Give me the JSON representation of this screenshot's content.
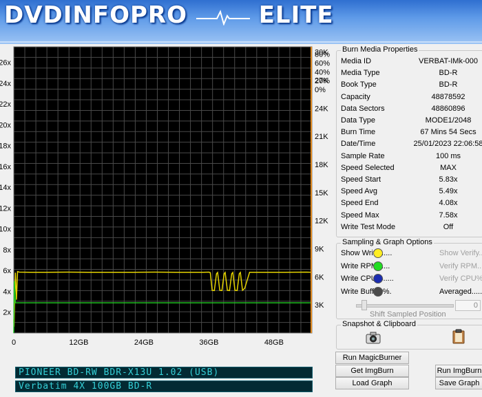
{
  "banner": {
    "left_text": "DVDINFOPRO",
    "right_text": "ELITE"
  },
  "chart_data": {
    "type": "line",
    "xlabel": "",
    "ylabel": "",
    "x_ticks": [
      "0",
      "12GB",
      "24GB",
      "36GB",
      "48GB"
    ],
    "x_range": [
      0,
      55
    ],
    "y_left_ticks": [
      "2x",
      "4x",
      "6x",
      "8x",
      "10x",
      "12x",
      "14x",
      "16x",
      "18x",
      "20x",
      "22x",
      "24x",
      "26x"
    ],
    "y_left_range": [
      0,
      27.5
    ],
    "y_right_ticks_rpm": [
      "3K",
      "6K",
      "9K",
      "12K",
      "15K",
      "18K",
      "21K",
      "24K",
      "27K",
      "30K"
    ],
    "y_right_ticks_percent": [
      "0%",
      "20%",
      "40%",
      "60%",
      "80%"
    ],
    "grid": true,
    "series": [
      {
        "color": "#e6d400",
        "x": [
          0,
          0.05,
          0.15,
          0.3,
          0.5,
          0.7,
          1,
          3,
          6,
          10,
          14,
          18,
          22,
          26,
          30,
          33,
          35,
          36,
          36.25,
          36.6,
          37,
          37.4,
          37.6,
          38,
          38.4,
          38.8,
          39,
          39.4,
          39.8,
          40.2,
          40.4,
          40.8,
          41.2,
          41.6,
          41.8,
          42.2,
          42.6,
          43.5,
          46,
          50,
          54,
          55
        ],
        "y": [
          1.3,
          0.6,
          3,
          5.8,
          3.2,
          5.9,
          5.85,
          5.83,
          5.83,
          5.85,
          5.83,
          5.84,
          5.83,
          5.85,
          5.83,
          5.84,
          5.83,
          5.85,
          5.8,
          4.1,
          4.08,
          5.7,
          5.82,
          4.1,
          4.08,
          5.7,
          5.82,
          4.1,
          4.08,
          5.7,
          5.82,
          4.1,
          4.08,
          5.7,
          5.82,
          4.1,
          4.3,
          5.83,
          5.84,
          5.83,
          5.85,
          5.83
        ]
      },
      {
        "color": "#1fc01f",
        "x": [
          0,
          0.1,
          0.3,
          55
        ],
        "y": [
          0,
          5,
          2.9,
          2.9
        ]
      }
    ]
  },
  "props": {
    "title": "Burn Media Properties",
    "rows": [
      {
        "label": "Media ID",
        "value": "VERBAT-IMk-000"
      },
      {
        "label": "Media Type",
        "value": "BD-R"
      },
      {
        "label": "Book Type",
        "value": "BD-R"
      },
      {
        "label": "Capacity",
        "value": "48878592"
      },
      {
        "label": "Data Sectors",
        "value": "48860896"
      },
      {
        "label": "Data Type",
        "value": "MODE1/2048"
      },
      {
        "label": "Burn Time",
        "value": "67 Mins 54 Secs"
      },
      {
        "label": "Date/Time",
        "value": "25/01/2023 22:06:58"
      },
      {
        "label": "Sample Rate",
        "value": "100 ms"
      },
      {
        "label": "Speed Selected",
        "value": "MAX"
      },
      {
        "label": "Speed Start",
        "value": "5.83x"
      },
      {
        "label": "Speed Avg",
        "value": "5.49x"
      },
      {
        "label": "Speed End",
        "value": "4.08x"
      },
      {
        "label": "Speed Max",
        "value": "7.58x"
      },
      {
        "label": "Write Test Mode",
        "value": "Off"
      }
    ]
  },
  "sampling": {
    "title": "Sampling & Graph Options",
    "options": [
      {
        "label": "Show Write......",
        "color": "#ffee22",
        "right": "Show Verify..."
      },
      {
        "label": "Write RPM......",
        "color": "#22dd22",
        "right": "Verify RPM..."
      },
      {
        "label": "Write CPU%.....",
        "color": "#1b2db0",
        "right": "Verify CPU%..."
      },
      {
        "label": "Write Buffer %.",
        "color": "#4a4a4a",
        "right": "Averaged....."
      }
    ],
    "slider_value": "0",
    "slider_caption": "Shift Sampled Position"
  },
  "snapshot": {
    "title": "Snapshot & Clipboard"
  },
  "buttons": {
    "run_magicburner": "Run MagicBurner",
    "get_imgburn": "Get ImgBurn",
    "run_imgburn": "Run ImgBurn",
    "load_graph": "Load Graph",
    "save_graph": "Save Graph"
  },
  "drive": {
    "line1": "PIONEER BD-RW BDR-X13U 1.02 (USB)",
    "line2": "Verbatim 4X 100GB BD-R"
  }
}
